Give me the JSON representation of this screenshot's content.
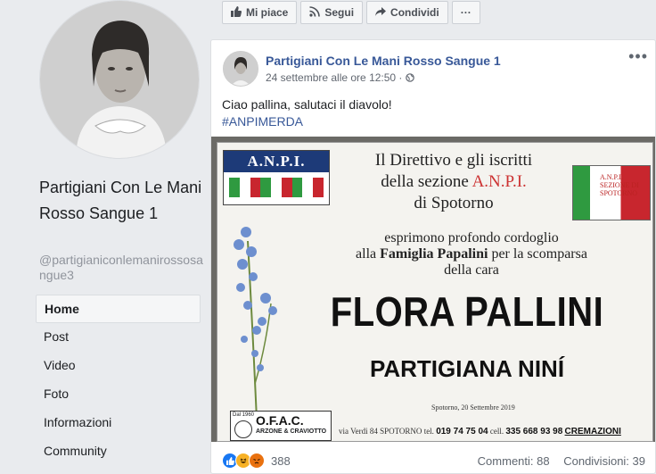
{
  "page": {
    "name": "Partigiani Con Le Mani Rosso Sangue 1",
    "handle": "@partigianiconlemanirossosangue3"
  },
  "sidebar": {
    "items": [
      {
        "label": "Home",
        "active": true
      },
      {
        "label": "Post"
      },
      {
        "label": "Video"
      },
      {
        "label": "Foto"
      },
      {
        "label": "Informazioni"
      },
      {
        "label": "Community"
      }
    ]
  },
  "actions": {
    "like": "Mi piace",
    "follow": "Segui",
    "share": "Condividi",
    "more": "···"
  },
  "post": {
    "author": "Partigiani Con Le Mani Rosso Sangue 1",
    "time": "24 settembre alle ore 12:50 ·",
    "text": "Ciao pallina, salutaci il diavolo!",
    "hashtag": "#ANPIMERDA",
    "more": "•••",
    "reactions_count": "388",
    "comments": "Commenti: 88",
    "shares": "Condivisioni: 39"
  },
  "notice": {
    "logo": "A.N.P.I.",
    "head_1": "Il Direttivo e gli iscritti",
    "head_2a": "della sezione ",
    "head_2b": "A.N.P.I.",
    "head_3": "di Spotorno",
    "body_1": "esprimono profondo cordoglio",
    "body_2a": "alla ",
    "body_2b": "Famiglia Papalini",
    "body_2c": " per la scomparsa",
    "body_3": "della cara",
    "name": "FLORA PALLINI",
    "subtitle": "PARTIGIANA NINÍ",
    "date": "Spotorno, 20 Settembre 2019",
    "flag_text": "A.N.P.I. SEZIONE DI SPOTORNO",
    "ofac_year": "Dal 1960",
    "ofac_name": "O.F.A.C.",
    "ofac_sub": "ARZONE & CRAVIOTTO",
    "address": "via Verdi 84 SPOTORNO",
    "tel_label": "tel.",
    "tel": "019 74 75 04",
    "cell_label": "cell.",
    "cell": "335 668 93 98",
    "cremazioni": "CREMAZIONI"
  },
  "colors": {
    "link": "#385898",
    "background": "#e9ebee",
    "anpi_blue": "#1d3a78",
    "like_blue": "#1877f2",
    "haha_yellow": "#f7b125",
    "angry_orange": "#e9710f"
  },
  "icons": {
    "like": "thumbs-up-icon",
    "follow": "rss-icon",
    "share": "share-arrow-icon",
    "privacy": "globe-icon"
  }
}
